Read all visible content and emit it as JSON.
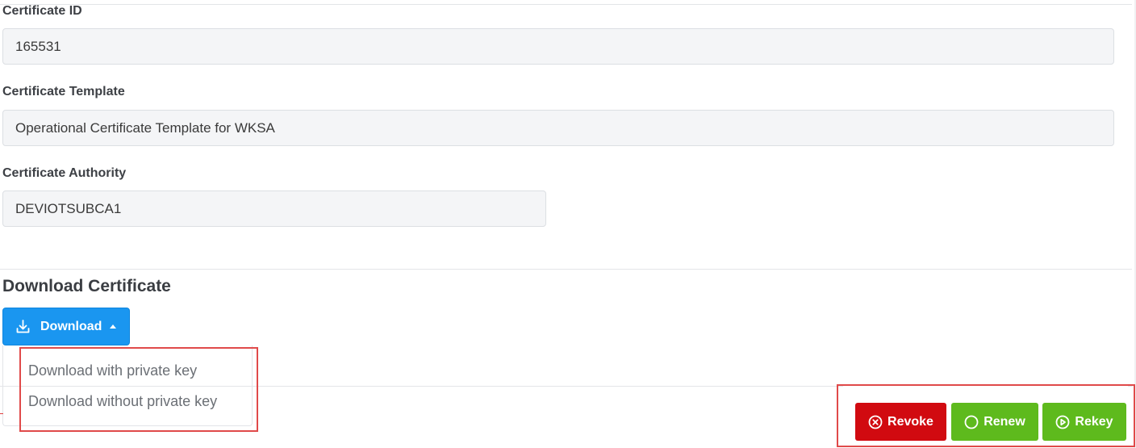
{
  "fields": [
    {
      "label": "Certificate ID",
      "value": "165531"
    },
    {
      "label": "Certificate Template",
      "value": "Operational Certificate Template for WKSA"
    },
    {
      "label": "Certificate Authority",
      "value": "DEVIOTSUBCA1"
    }
  ],
  "download": {
    "heading": "Download Certificate",
    "button_label": "Download",
    "menu_items": [
      "Download with private key",
      "Download without private key"
    ]
  },
  "actions": {
    "revoke": "Revoke",
    "renew": "Renew",
    "rekey": "Rekey"
  },
  "colors": {
    "primary": "#1a96f0",
    "danger": "#d10a10",
    "success": "#5eba1d",
    "highlight": "#e04a4a"
  },
  "icons": {
    "download": "download-icon",
    "caret": "caret-up-icon",
    "revoke": "x-circle-icon",
    "renew": "circle-icon",
    "rekey": "play-circle-icon"
  }
}
